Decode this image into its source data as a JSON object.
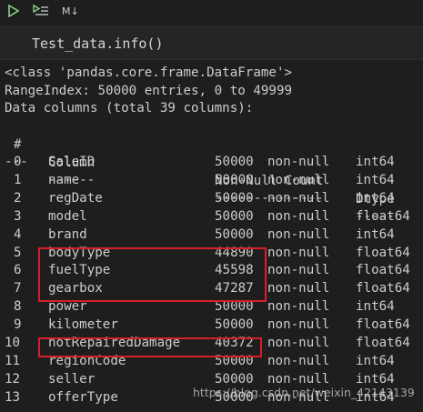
{
  "toolbar": {
    "run_icon": "play-icon",
    "run_below_icon": "run-below-icon",
    "markdown_label": "M↓"
  },
  "cell": {
    "code": "Test_data.info()"
  },
  "output": {
    "class_line": "<class 'pandas.core.frame.DataFrame'>",
    "range_line": "RangeIndex: 50000 entries, 0 to 49999",
    "columns_line": "Data columns (total 39 columns):",
    "header": {
      "idx": "#",
      "column": "Column",
      "count": "Non-Null Count",
      "dtype": "Dtype"
    },
    "separator": {
      "idx": "---",
      "column": "------",
      "count": "--------------",
      "dtype": "-----"
    },
    "rows": [
      {
        "idx": "0",
        "column": "SaleID",
        "count": "50000",
        "nonnull": "non-null",
        "dtype": "int64"
      },
      {
        "idx": "1",
        "column": "name",
        "count": "50000",
        "nonnull": "non-null",
        "dtype": "int64"
      },
      {
        "idx": "2",
        "column": "regDate",
        "count": "50000",
        "nonnull": "non-null",
        "dtype": "int64"
      },
      {
        "idx": "3",
        "column": "model",
        "count": "50000",
        "nonnull": "non-null",
        "dtype": "float64"
      },
      {
        "idx": "4",
        "column": "brand",
        "count": "50000",
        "nonnull": "non-null",
        "dtype": "int64"
      },
      {
        "idx": "5",
        "column": "bodyType",
        "count": "44890",
        "nonnull": "non-null",
        "dtype": "float64"
      },
      {
        "idx": "6",
        "column": "fuelType",
        "count": "45598",
        "nonnull": "non-null",
        "dtype": "float64"
      },
      {
        "idx": "7",
        "column": "gearbox",
        "count": "47287",
        "nonnull": "non-null",
        "dtype": "float64"
      },
      {
        "idx": "8",
        "column": "power",
        "count": "50000",
        "nonnull": "non-null",
        "dtype": "int64"
      },
      {
        "idx": "9",
        "column": "kilometer",
        "count": "50000",
        "nonnull": "non-null",
        "dtype": "float64"
      },
      {
        "idx": "10",
        "column": "notRepairedDamage",
        "count": "40372",
        "nonnull": "non-null",
        "dtype": "float64"
      },
      {
        "idx": "11",
        "column": "regionCode",
        "count": "50000",
        "nonnull": "non-null",
        "dtype": "int64"
      },
      {
        "idx": "12",
        "column": "seller",
        "count": "50000",
        "nonnull": "non-null",
        "dtype": "int64"
      },
      {
        "idx": "13",
        "column": "offerType",
        "count": "50000",
        "nonnull": "non-null",
        "dtype": "int64"
      }
    ]
  },
  "watermark": "https://blog.csdn.net/weixin_42143139",
  "colors": {
    "background": "#1e1e1e",
    "text": "#cccccc",
    "highlight": "#d81e2a",
    "run": "#89d185"
  }
}
